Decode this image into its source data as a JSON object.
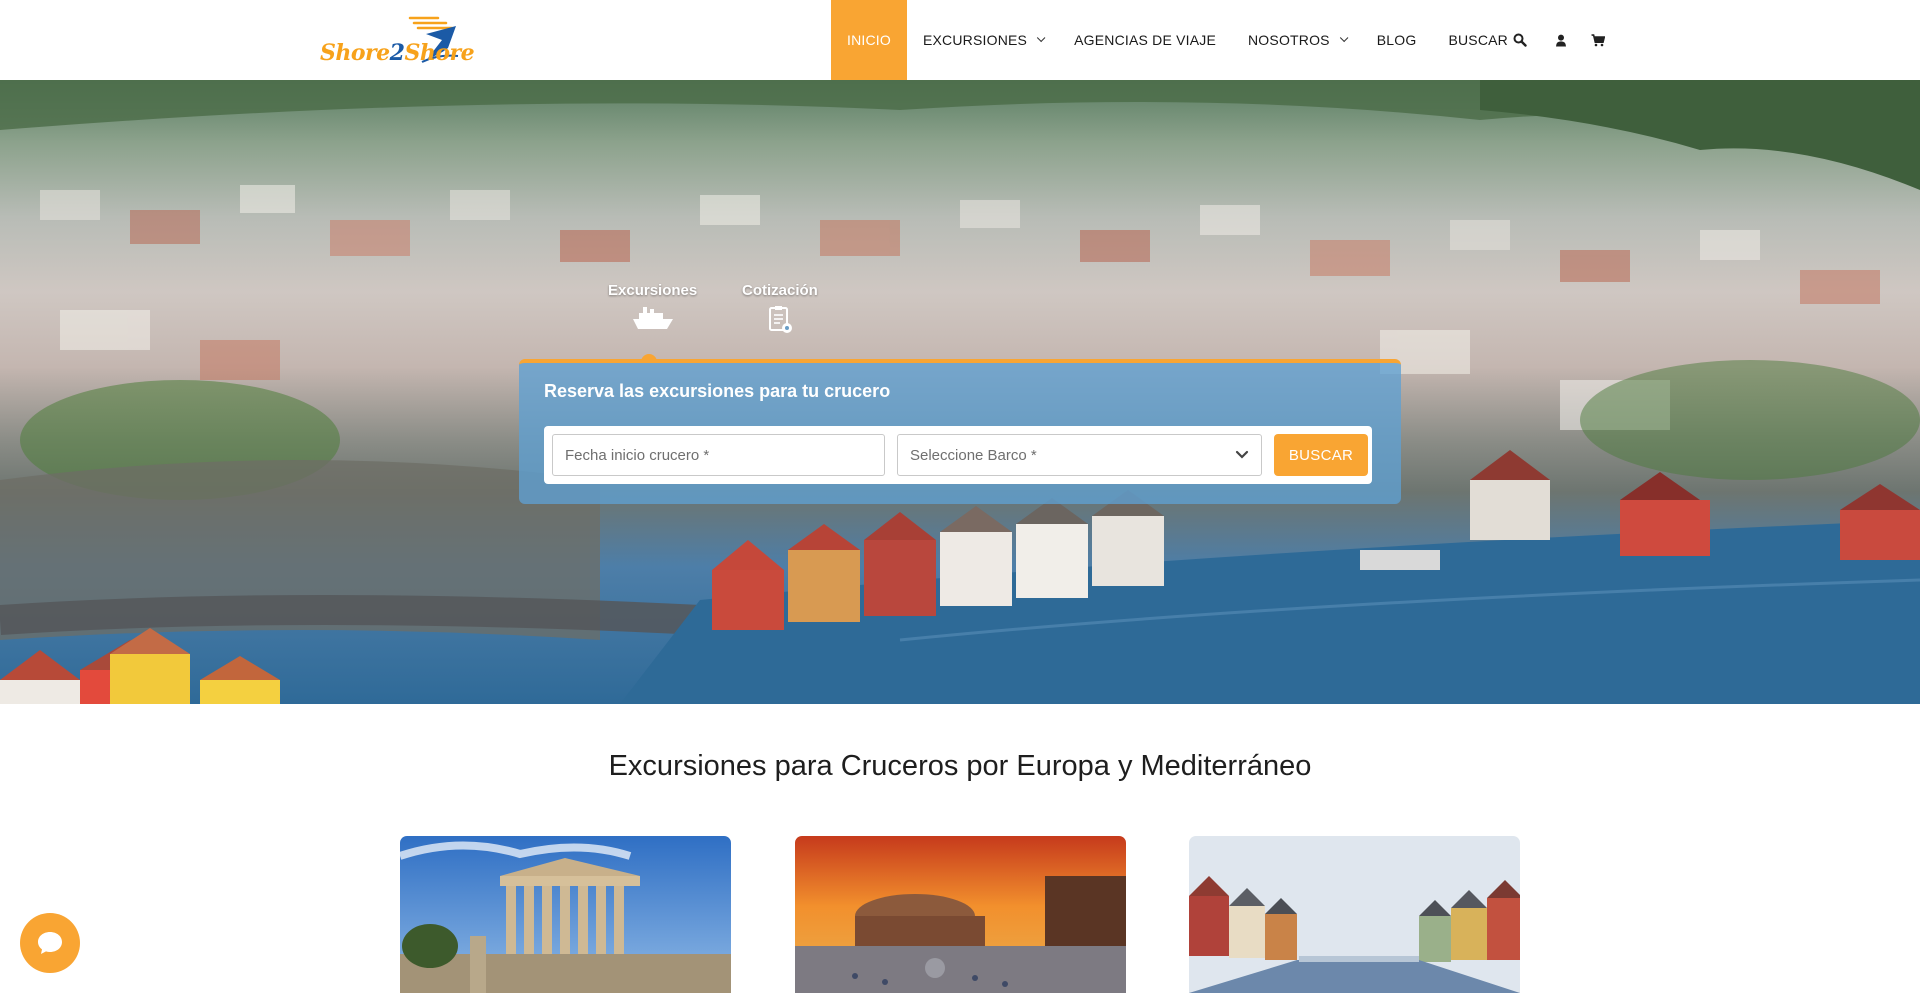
{
  "header": {
    "logo": {
      "part1": "Shore",
      "part2": "2",
      "part3": "Shore"
    },
    "nav": [
      {
        "label": "INICIO",
        "active": true,
        "dropdown": false
      },
      {
        "label": "EXCURSIONES",
        "active": false,
        "dropdown": true
      },
      {
        "label": "AGENCIAS DE VIAJE",
        "active": false,
        "dropdown": false
      },
      {
        "label": "NOSOTROS",
        "active": false,
        "dropdown": true
      },
      {
        "label": "BLOG",
        "active": false,
        "dropdown": false
      },
      {
        "label": "BUSCAR",
        "active": false,
        "dropdown": false,
        "icon": "search-icon"
      }
    ],
    "icons": [
      "user-icon",
      "cart-icon"
    ]
  },
  "hero": {
    "tabs": [
      {
        "label": "Excursiones",
        "icon": "cruise-ship-icon",
        "selected": true
      },
      {
        "label": "Cotización",
        "icon": "quote-document-icon",
        "selected": false
      }
    ],
    "booking": {
      "title": "Reserva las excursiones para tu crucero",
      "date_placeholder": "Fecha inicio crucero *",
      "ship_select": "Seleccione Barco *",
      "submit_label": "BUSCAR"
    }
  },
  "section": {
    "title": "Excursiones para Cruceros por Europa y Mediterráneo",
    "cards": [
      {
        "image": "acropolis-photo"
      },
      {
        "image": "rhodes-sunset-photo"
      },
      {
        "image": "trondheim-harbor-photo"
      }
    ]
  },
  "chat": {
    "icon": "chat-icon"
  },
  "colors": {
    "accent": "#f9a533",
    "brand_blue": "#1b5aa6",
    "panel": "rgba(95,160,210,0.78)"
  }
}
